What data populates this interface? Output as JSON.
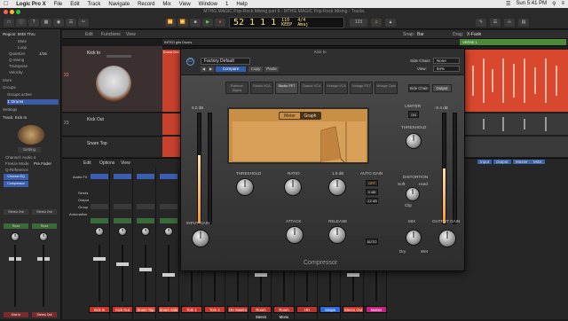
{
  "menubar": {
    "app": "Logic Pro X",
    "items": [
      "File",
      "Edit",
      "Track",
      "Navigate",
      "Record",
      "Mix",
      "View",
      "Window",
      "1",
      "Help"
    ],
    "clock": "Sun 5:41 PM"
  },
  "window": {
    "title": "MTHG MAGIC Pop-Rock Mixing part 6 - MTHG MAGIC Pop-Rock Mixing - Tracks"
  },
  "lcd": {
    "bar": "52",
    "beat": "1",
    "div": "1",
    "tick": "1",
    "tempo": "110",
    "keep": "KEEP",
    "tempo_label": "TEMPO",
    "sig": "4/4",
    "key": "Amaj"
  },
  "toolbar": {
    "count": "123"
  },
  "inspector": {
    "region": "Region: MIDI Thru",
    "mute": "Mute",
    "loop": "Loop",
    "quantize": "Quantize",
    "quantize_val": "1/16",
    "q_swing": "Q-Swing",
    "transpose": "Transpose",
    "velocity": "Velocity",
    "more": "More",
    "groups": "Groups",
    "groups_active": "Groups active",
    "group_name": "1: Drums",
    "settings": "Settings",
    "track": "Track: Kick In",
    "setting_btn": "Setting",
    "channel": "Channel: Audio 4",
    "freeze": "Freeze Mode",
    "freeze_val": "Pre Fader",
    "q_ref": "Q-Reference",
    "flex": "Flex Mode"
  },
  "tracks_header": {
    "edit": "Edit",
    "functions": "Functions",
    "view": "View",
    "snap_label": "Snap:",
    "snap_val": "Bar",
    "drag_label": "Drag:",
    "drag_val": "X-Fade"
  },
  "tracks": [
    {
      "number": "22",
      "name": "Kick In"
    },
    {
      "number": "23",
      "name": "Kick Out"
    },
    {
      "number": "",
      "name": "Snare Top"
    }
  ],
  "regions": {
    "drums_label": "Drums Kick",
    "verse": "VERSE 1",
    "intro": "INTRO g/ts Drums"
  },
  "mixer": {
    "edit": "Edit",
    "options": "Options",
    "view": "View",
    "tabs": [
      "Input",
      "Output",
      "Master",
      "MIDI"
    ],
    "labels": [
      "Audio FX",
      "Sends",
      "Output",
      "Group",
      "Automation"
    ],
    "plug_a": "Channel EQ",
    "plug_b": "Compressor",
    "out": "Stereo Out",
    "read": "Read",
    "vals": [
      "0.0",
      "-1.8",
      "0.0",
      "-2.4",
      "0.0",
      "0.0",
      "-6.2"
    ],
    "channels": [
      {
        "name": "Kick In",
        "color": "#c8362a"
      },
      {
        "name": "Kick Out",
        "color": "#c8362a"
      },
      {
        "name": "Snare Top",
        "color": "#d4442e"
      },
      {
        "name": "Snare Side",
        "color": "#d4442e"
      },
      {
        "name": "Tom 1",
        "color": "#c8362a"
      },
      {
        "name": "Tom 2",
        "color": "#c8362a"
      },
      {
        "name": "OH Mastro",
        "color": "#b9342a"
      },
      {
        "name": "Room Stereo",
        "color": "#b9342a"
      },
      {
        "name": "Room Mono",
        "color": "#b9342a"
      },
      {
        "name": "HH",
        "color": "#b9342a"
      },
      {
        "name": "Snaps",
        "color": "#2c6ad9"
      },
      {
        "name": "Stereo Out",
        "color": "#c8362a"
      },
      {
        "name": "Master",
        "color": "#c81f84"
      }
    ]
  },
  "plugin": {
    "title": "Kick In",
    "preset": "Factory Default",
    "compare": "Compare",
    "copy": "Copy",
    "paste": "Paste",
    "side_chain_label": "Side Chain:",
    "side_chain_val": "None",
    "view_label": "View:",
    "view_val": "94%",
    "models": [
      "Platinum Digital",
      "Studio VCA",
      "Studio FET",
      "Classic VCA",
      "Vintage VCA",
      "Vintage FET",
      "Vintage Opto"
    ],
    "side_chain_btn": "Side Chain",
    "output_btn": "Output",
    "meter_tab": "Meter",
    "graph_tab": "Graph",
    "input_db": "0.0 dB",
    "limiter": "LIMITER",
    "limiter_on": "ON",
    "limiter_val": "-0.4 dB",
    "threshold": "THRESHOLD",
    "ratio": "RATIO",
    "ratio_val": "1.5 dB",
    "auto_gain": "AUTO GAIN",
    "auto_off": "OFF",
    "auto_0": "0 dB",
    "auto_m12": "-12 dB",
    "right_threshold": "THRESHOLD",
    "distortion": "DISTORTION",
    "dist_soft": "Soft",
    "dist_hard": "Hard",
    "dist_clip": "Clip",
    "input_gain": "INPUT GAIN",
    "attack": "ATTACK",
    "release": "RELEASE",
    "mix": "MIX",
    "output_gain": "OUTPUT GAIN",
    "auto_btn": "AUTO",
    "dry": "Dry",
    "wet": "Wet",
    "name": "Compressor",
    "input_meter_level": 0.62,
    "output_meter_level": 0.5
  }
}
